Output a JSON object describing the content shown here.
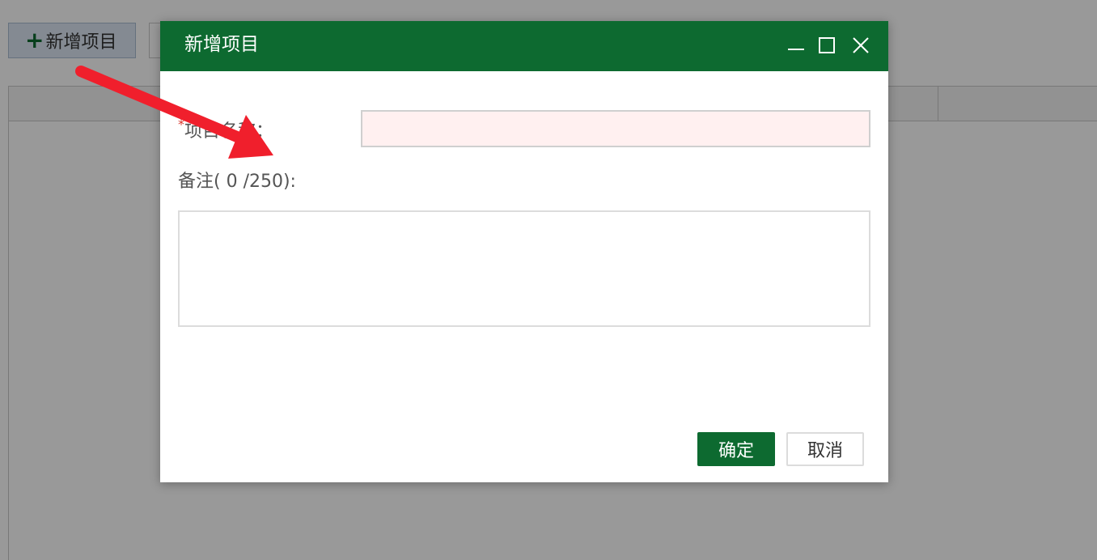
{
  "background": {
    "add_button_label": "新增项目"
  },
  "dialog": {
    "title": "新增项目",
    "fields": {
      "name": {
        "required_mark": "*",
        "label": "项目名称：",
        "value": "",
        "placeholder": ""
      },
      "remark": {
        "label": "备注( 0 /250):",
        "value": "",
        "placeholder": ""
      }
    },
    "buttons": {
      "ok": "确定",
      "cancel": "取消"
    }
  },
  "colors": {
    "header": "#0d6a30",
    "annotation_arrow": "#f01f2c",
    "required_input_bg": "#fff0f0"
  },
  "icons": {
    "minimize": "minimize-icon",
    "maximize": "maximize-icon",
    "close": "close-icon",
    "add": "plus-icon"
  }
}
